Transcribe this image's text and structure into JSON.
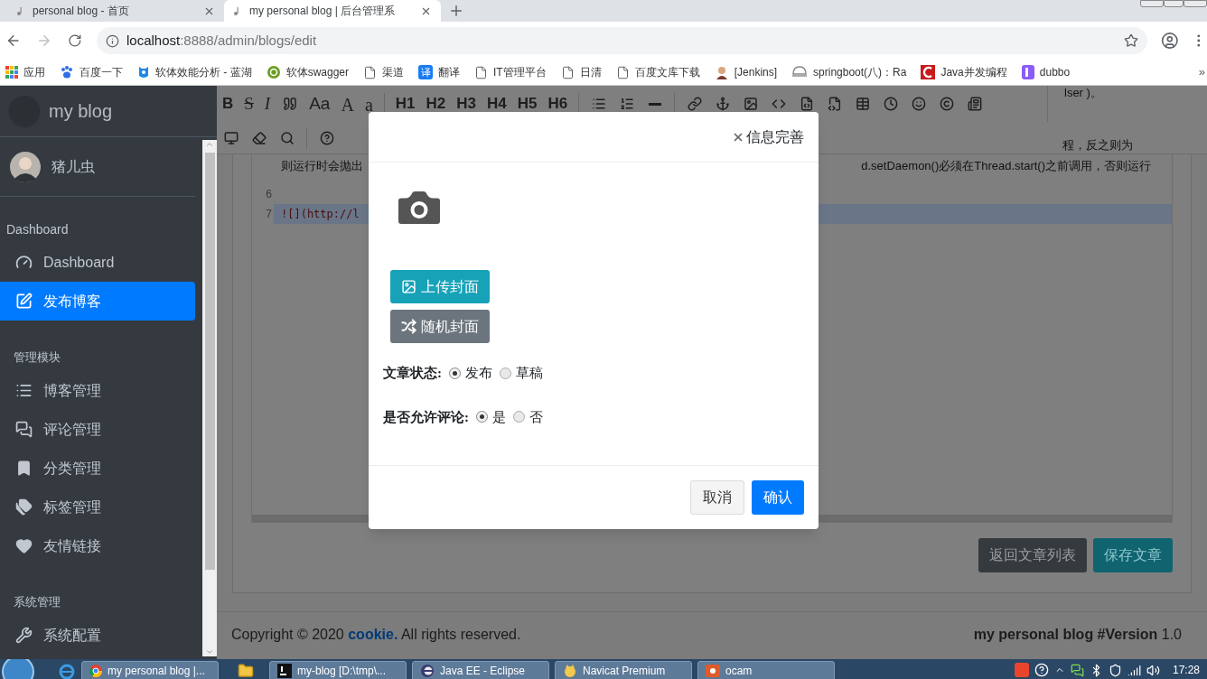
{
  "browser": {
    "tabs": [
      {
        "title": "personal blog - 首页",
        "selected": false
      },
      {
        "title": "my personal blog | 后台管理系",
        "selected": true
      }
    ],
    "address": {
      "host": "localhost",
      "path": ":8888/admin/blogs/edit"
    },
    "bookmarks": [
      {
        "label": "应用",
        "kind": "apps"
      },
      {
        "label": "百度一下",
        "kind": "paw"
      },
      {
        "label": "软体效能分析 - 蓝湖",
        "kind": "bird"
      },
      {
        "label": "软体swagger",
        "kind": "swagger"
      },
      {
        "label": "渠道",
        "kind": "page"
      },
      {
        "label": "翻译",
        "kind": "glyph",
        "glyph": "译"
      },
      {
        "label": "IT管理平台",
        "kind": "page"
      },
      {
        "label": "日清",
        "kind": "page"
      },
      {
        "label": "百度文库下载",
        "kind": "page"
      },
      {
        "label": "[Jenkins]",
        "kind": "person"
      },
      {
        "label": "springboot(八)：Ra",
        "kind": "robot"
      },
      {
        "label": "Java并发编程",
        "kind": "arc"
      },
      {
        "label": "dubbo",
        "kind": "purple"
      }
    ],
    "bookmarks_more": "»"
  },
  "sidebar": {
    "brand": "my blog",
    "user": "猪儿虫",
    "sections": [
      {
        "title": "Dashboard",
        "items": [
          {
            "label": "Dashboard",
            "selected": false
          },
          {
            "label": "发布博客",
            "selected": true
          }
        ]
      },
      {
        "title": "管理模块",
        "items": [
          {
            "label": "博客管理",
            "selected": false
          },
          {
            "label": "评论管理",
            "selected": false
          },
          {
            "label": "分类管理",
            "selected": false
          },
          {
            "label": "标签管理",
            "selected": false
          },
          {
            "label": "友情链接",
            "selected": false
          }
        ]
      },
      {
        "title": "系统管理",
        "items": [
          {
            "label": "系统配置",
            "selected": false
          }
        ]
      }
    ]
  },
  "editor": {
    "toolbar": [
      [
        {
          "kind": "bold",
          "label": "B"
        },
        {
          "kind": "strike",
          "label": "S"
        },
        {
          "kind": "italic",
          "label": "I"
        },
        {
          "kind": "icon"
        },
        {
          "kind": "text",
          "label": "Aa"
        },
        {
          "kind": "serif",
          "label": "A"
        },
        {
          "kind": "serif",
          "label": "a"
        },
        {
          "kind": "divider"
        },
        {
          "kind": "bold",
          "label": "H1"
        },
        {
          "kind": "bold",
          "label": "H2"
        },
        {
          "kind": "bold",
          "label": "H3"
        },
        {
          "kind": "bold",
          "label": "H4"
        },
        {
          "kind": "bold",
          "label": "H5"
        },
        {
          "kind": "bold",
          "label": "H6"
        },
        {
          "kind": "divider"
        },
        {
          "kind": "icon"
        },
        {
          "kind": "icon"
        },
        {
          "kind": "icon"
        },
        {
          "kind": "divider"
        },
        {
          "kind": "icon"
        },
        {
          "kind": "icon"
        },
        {
          "kind": "icon"
        },
        {
          "kind": "icon"
        },
        {
          "kind": "icon"
        },
        {
          "kind": "icon"
        },
        {
          "kind": "icon"
        },
        {
          "kind": "icon"
        },
        {
          "kind": "icon"
        },
        {
          "kind": "icon"
        },
        {
          "kind": "icon"
        }
      ],
      [
        {
          "kind": "icon"
        },
        {
          "kind": "icon"
        },
        {
          "kind": "icon"
        },
        {
          "kind": "divider"
        },
        {
          "kind": "icon"
        }
      ]
    ],
    "toolbar_tails": [
      "lser )。",
      "程，反之则为"
    ],
    "lines": [
      {
        "left": "则运行时会抛出",
        "right": "d.setDaemon()必须在Thread.start()之前调用，否则运行",
        "active": false
      },
      {
        "number": "6",
        "active": false
      },
      {
        "number": "7",
        "left": "![](http://l",
        "active": true
      }
    ],
    "buttons": [
      {
        "label": "返回文章列表",
        "kind": "secondary"
      },
      {
        "label": "保存文章",
        "kind": "primary"
      }
    ]
  },
  "footer": {
    "before": "Copyright © 2020 ",
    "owner": "cookie.",
    "after": " All rights reserved.",
    "version": "**my personal blog #Version** 1.0"
  },
  "modal": {
    "title": "信息完善",
    "cover_buttons": [
      {
        "label": "上传封面",
        "kind": "upload"
      },
      {
        "label": "随机封面",
        "kind": "random"
      }
    ],
    "fields": [
      {
        "label": "文章状态:",
        "options": [
          {
            "label": "发布",
            "selected": true
          },
          {
            "label": "草稿",
            "selected": false
          }
        ]
      },
      {
        "label": "是否允许评论:",
        "options": [
          {
            "label": "是",
            "selected": true
          },
          {
            "label": "否",
            "selected": false
          }
        ]
      }
    ],
    "buttons": [
      {
        "label": "取消",
        "kind": "secondary"
      },
      {
        "label": "确认",
        "kind": "primary"
      }
    ]
  },
  "taskbar": {
    "items": [
      {
        "label": "my personal blog |...",
        "kind": "chrome"
      },
      {
        "kind": "folder"
      },
      {
        "label": "my-blog [D:\\tmp\\...",
        "kind": "idea"
      },
      {
        "label": "Java EE - Eclipse",
        "kind": "eclipse"
      },
      {
        "label": "Navicat Premium",
        "kind": "navicat"
      },
      {
        "label": "ocam",
        "kind": "ocam"
      }
    ],
    "clock": "17:28"
  }
}
